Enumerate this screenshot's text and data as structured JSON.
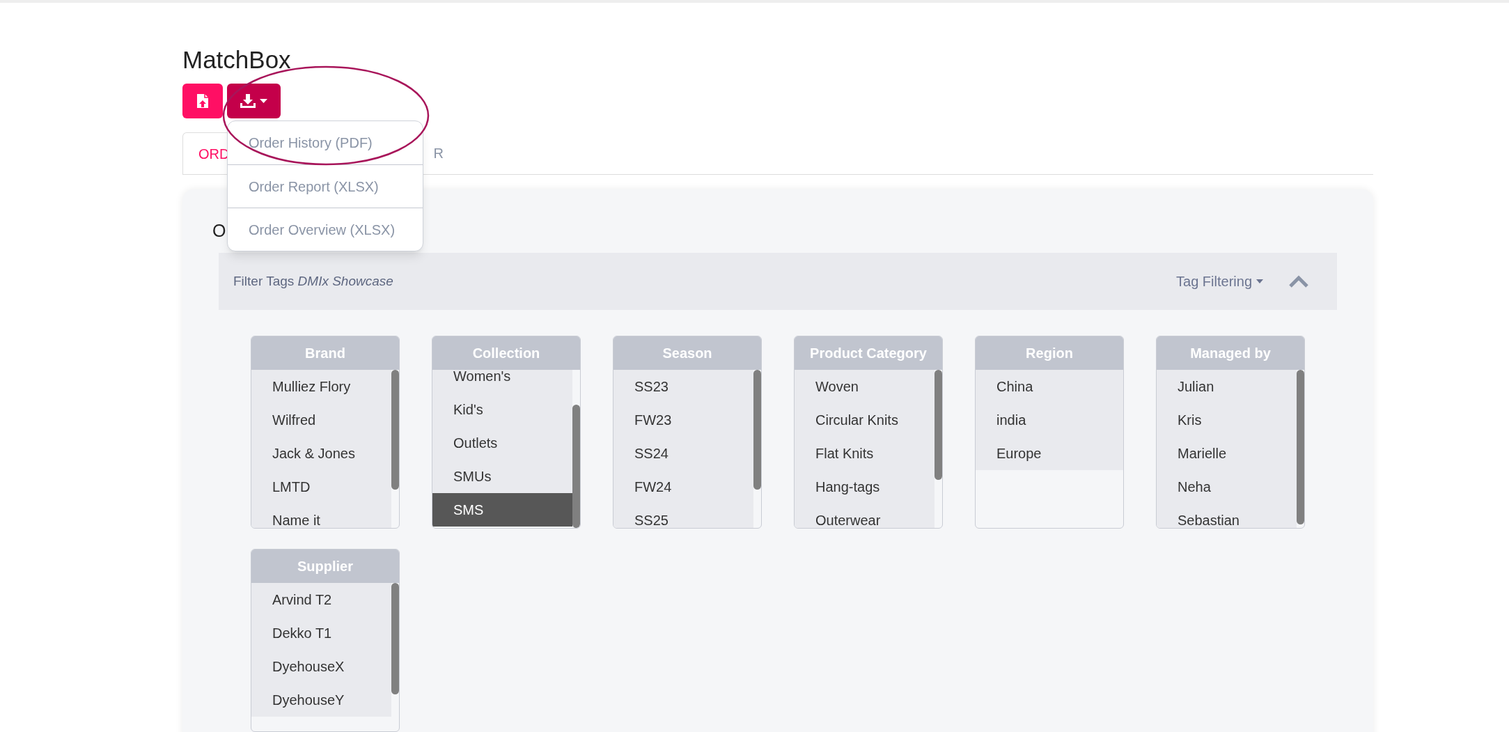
{
  "app_title": "MatchBox",
  "export_menu": {
    "expanded": true,
    "items": [
      {
        "label": "Order History (PDF)"
      },
      {
        "label": "Order Report (XLSX)"
      },
      {
        "label": "Order Overview (XLSX)"
      }
    ]
  },
  "tabs": [
    {
      "label": "ORD",
      "selected": true
    },
    {
      "label": "R",
      "selected": false
    }
  ],
  "card": {
    "heading": "O",
    "filter_bar": {
      "label": "Filter Tags *DMIx Showcase*",
      "tag_filtering": "Tag Filtering",
      "expanded": true
    },
    "filters": [
      {
        "title": "Brand",
        "items": [
          {
            "label": "Mulliez Flory",
            "selected": false
          },
          {
            "label": "Wilfred",
            "selected": false
          },
          {
            "label": "Jack & Jones",
            "selected": false
          },
          {
            "label": "LMTD",
            "selected": false
          },
          {
            "label": "Name it",
            "selected": false
          }
        ]
      },
      {
        "title": "Collection",
        "items": [
          {
            "label": "Women's",
            "selected": false
          },
          {
            "label": "Kid's",
            "selected": false
          },
          {
            "label": "Outlets",
            "selected": false
          },
          {
            "label": "SMUs",
            "selected": false
          },
          {
            "label": "SMS",
            "selected": true
          }
        ]
      },
      {
        "title": "Season",
        "items": [
          {
            "label": "SS23",
            "selected": false
          },
          {
            "label": "FW23",
            "selected": false
          },
          {
            "label": "SS24",
            "selected": false
          },
          {
            "label": "FW24",
            "selected": false
          },
          {
            "label": "SS25",
            "selected": false
          }
        ]
      },
      {
        "title": "Product Category",
        "items": [
          {
            "label": "Woven",
            "selected": false
          },
          {
            "label": "Circular Knits",
            "selected": false
          },
          {
            "label": "Flat Knits",
            "selected": false
          },
          {
            "label": "Hang-tags",
            "selected": false
          },
          {
            "label": "Outerwear",
            "selected": false
          }
        ]
      },
      {
        "title": "Region",
        "items": [
          {
            "label": "China",
            "selected": false
          },
          {
            "label": "india",
            "selected": false
          },
          {
            "label": "Europe",
            "selected": false
          }
        ]
      },
      {
        "title": "Managed by",
        "items": [
          {
            "label": "Julian",
            "selected": false
          },
          {
            "label": "Kris",
            "selected": false
          },
          {
            "label": "Marielle",
            "selected": false
          },
          {
            "label": "Neha",
            "selected": false
          },
          {
            "label": "Sebastian",
            "selected": false
          }
        ]
      },
      {
        "title": "Supplier",
        "items": [
          {
            "label": "Arvind T2",
            "selected": false
          },
          {
            "label": "Dekko T1",
            "selected": false
          },
          {
            "label": "DyehouseX",
            "selected": false
          },
          {
            "label": "DyehouseY",
            "selected": false
          }
        ]
      }
    ]
  }
}
